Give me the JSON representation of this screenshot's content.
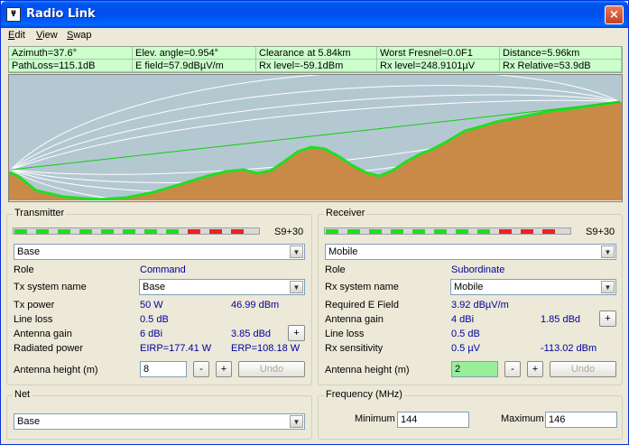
{
  "window": {
    "title": "Radio Link",
    "app_icon": "antenna-app-icon",
    "close_label": "×"
  },
  "menu": [
    {
      "label": "Edit",
      "key": "E",
      "rest": "dit"
    },
    {
      "label": "View",
      "key": "V",
      "rest": "iew"
    },
    {
      "label": "Swap",
      "key": "S",
      "rest": "wap"
    }
  ],
  "info": {
    "row1": [
      "Azimuth=37.6°",
      "Elev. angle=0.954°",
      "Clearance at 5.84km",
      "Worst Fresnel=0.0F1",
      "Distance=5.96km"
    ],
    "row2": [
      "PathLoss=115.1dB",
      "E field=57.9dBµV/m",
      "Rx level=-59.1dBm",
      "Rx level=248.9101µV",
      "Rx Relative=53.9dB"
    ]
  },
  "colors": {
    "terrain": "#c98a48",
    "terrain_line": "#22dd22",
    "los_line": "#11cc11",
    "sky": "#b4c8d2",
    "info_bg": "#ccffcc",
    "value_blue": "#00009e"
  },
  "transmitter": {
    "title": "Transmitter",
    "s_meter": "S9+30",
    "station": "Base",
    "role_label": "Role",
    "role_value": "Command",
    "tx_system_label": "Tx system name",
    "tx_system_value": "Base",
    "tx_power_label": "Tx power",
    "tx_power_w": "50 W",
    "tx_power_dbm": "46.99 dBm",
    "line_loss_label": "Line loss",
    "line_loss_value": "0.5 dB",
    "antenna_gain_label": "Antenna gain",
    "antenna_gain_dbi": "6 dBi",
    "antenna_gain_dbd": "3.85 dBd",
    "radiated_label": "Radiated power",
    "eirp": "EIRP=177.41 W",
    "erp": "ERP=108.18 W",
    "antenna_height_label": "Antenna height (m)",
    "antenna_height_value": "8",
    "minus": "-",
    "plus": "+",
    "plus_small": "+",
    "undo": "Undo"
  },
  "receiver": {
    "title": "Receiver",
    "s_meter": "S9+30",
    "station": "Mobile",
    "role_label": "Role",
    "role_value": "Subordinate",
    "rx_system_label": "Rx system name",
    "rx_system_value": "Mobile",
    "req_field_label": "Required E Field",
    "req_field_value": "3.92 dBµV/m",
    "antenna_gain_label": "Antenna gain",
    "antenna_gain_dbi": "4 dBi",
    "antenna_gain_dbd": "1.85 dBd",
    "line_loss_label": "Line loss",
    "line_loss_value": "0.5 dB",
    "rx_sens_label": "Rx sensitivity",
    "rx_sens_uv": "0.5 µV",
    "rx_sens_dbm": "-113.02 dBm",
    "antenna_height_label": "Antenna height (m)",
    "antenna_height_value": "2",
    "minus": "-",
    "plus": "+",
    "plus_small": "+",
    "undo": "Undo"
  },
  "net": {
    "title": "Net",
    "value": "Base"
  },
  "frequency": {
    "title": "Frequency (MHz)",
    "min_label": "Minimum",
    "min_value": "144",
    "max_label": "Maximum",
    "max_value": "146"
  },
  "s_meter_pattern": [
    "g",
    "g",
    "g",
    "g",
    "g",
    "g",
    "g",
    "g",
    "r",
    "r",
    "r"
  ]
}
